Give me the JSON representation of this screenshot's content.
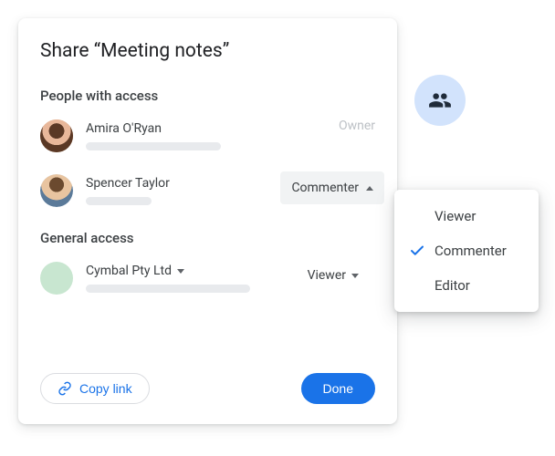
{
  "dialog": {
    "title": "Share “Meeting notes”",
    "sections": {
      "people_label": "People with access",
      "general_label": "General access"
    },
    "people": [
      {
        "name": "Amira O'Ryan",
        "role": "Owner"
      },
      {
        "name": "Spencer Taylor",
        "role": "Commenter"
      }
    ],
    "general": {
      "org_name": "Cymbal Pty Ltd",
      "role": "Viewer"
    },
    "footer": {
      "copy_link": "Copy link",
      "done": "Done"
    }
  },
  "dropdown": {
    "options": [
      {
        "label": "Viewer",
        "selected": false
      },
      {
        "label": "Commenter",
        "selected": true
      },
      {
        "label": "Editor",
        "selected": false
      }
    ]
  },
  "colors": {
    "primary": "#1a73e8",
    "bubble": "#d2e3fc"
  }
}
